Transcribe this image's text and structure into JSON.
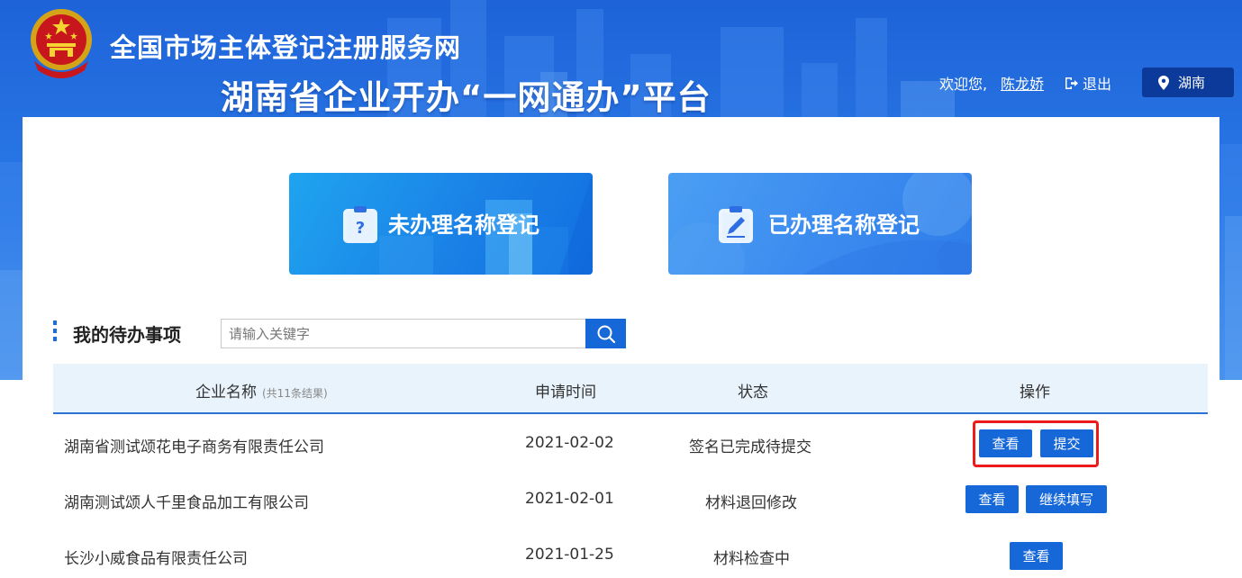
{
  "header": {
    "title_line1": "全国市场主体登记注册服务网",
    "title_line2": "湖南省企业开办“一网通办”平台",
    "welcome": "欢迎您,",
    "username": "陈龙娇",
    "logout": "退出",
    "region": "湖南"
  },
  "cards": [
    {
      "label": "未办理名称登记",
      "icon": "clipboard-question-icon"
    },
    {
      "label": "已办理名称登记",
      "icon": "clipboard-edit-icon"
    }
  ],
  "todo": {
    "title": "我的待办事项",
    "search_placeholder": "请输入关键字",
    "search_icon": "search-icon"
  },
  "table": {
    "columns": {
      "company": "企业名称",
      "count": "(共11条结果)",
      "date": "申请时间",
      "status": "状态",
      "actions": "操作"
    },
    "rows": [
      {
        "company": "湖南省测试颂花电子商务有限责任公司",
        "date": "2021-02-02",
        "status": "签名已完成待提交",
        "actions": [
          "查看",
          "提交"
        ]
      },
      {
        "company": "湖南测试颂人千里食品加工有限公司",
        "date": "2021-02-01",
        "status": "材料退回修改",
        "actions": [
          "查看",
          "继续填写"
        ]
      },
      {
        "company": "长沙小威食品有限责任公司",
        "date": "2021-01-25",
        "status": "材料检查中",
        "actions": [
          "查看"
        ]
      }
    ]
  },
  "colors": {
    "primary": "#1668d8",
    "banner": "#1e63d8",
    "highlight": "#ee1b1b",
    "region_button": "#0c3a9a"
  }
}
